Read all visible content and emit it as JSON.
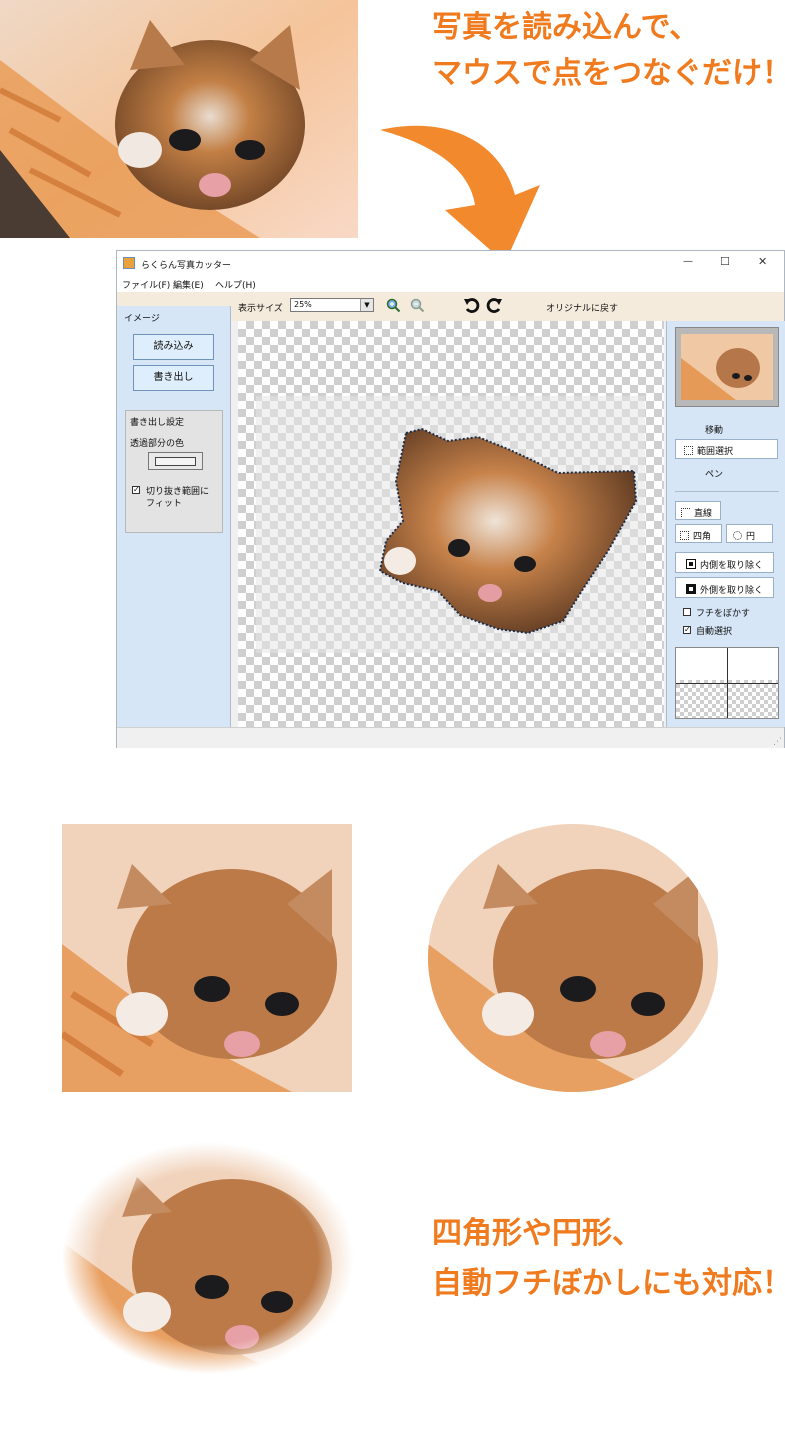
{
  "headline_top": {
    "line1": "写真を読み込んで、",
    "line2": "マウスで点をつなぐだけ！"
  },
  "headline_bottom": {
    "line1": "四角形や円形、",
    "line2": "自動フチぼかしにも対応！"
  },
  "window": {
    "title": "らくらん写真カッター",
    "controls": {
      "minimize": "—",
      "maximize": "☐",
      "close": "✕"
    },
    "menu": [
      "ファイル(F)",
      "編集(E)",
      "ヘルプ(H)"
    ],
    "toolbar": {
      "size_label": "表示サイズ",
      "size_value": "25%",
      "restore_label": "オリジナルに戻す"
    },
    "left_panel": {
      "tab_label": "イメージ",
      "load_button": "読み込み",
      "export_button": "書き出し",
      "export_settings": {
        "title": "書き出し設定",
        "transparent_label": "透過部分の色",
        "fit_checkbox": {
          "label_line1": "切り抜き範囲に",
          "label_line2": "フィット",
          "checked": true
        }
      }
    },
    "right_panel": {
      "move_label": "移動",
      "range_select_label": "範囲選択",
      "pen_label": "ペン",
      "line_label": "直線",
      "rect_label": "四角",
      "circle_label": "円",
      "remove_inside_label": "内側を取り除く",
      "remove_outside_label": "外側を取り除く",
      "blur_edge": {
        "label": "フチをぼかす",
        "checked": false
      },
      "auto_select": {
        "label": "自動選択",
        "checked": true
      }
    }
  },
  "colors": {
    "accent": "#f07a1e",
    "panel": "#d6e6f7",
    "toolbar": "#f5ebdc"
  }
}
